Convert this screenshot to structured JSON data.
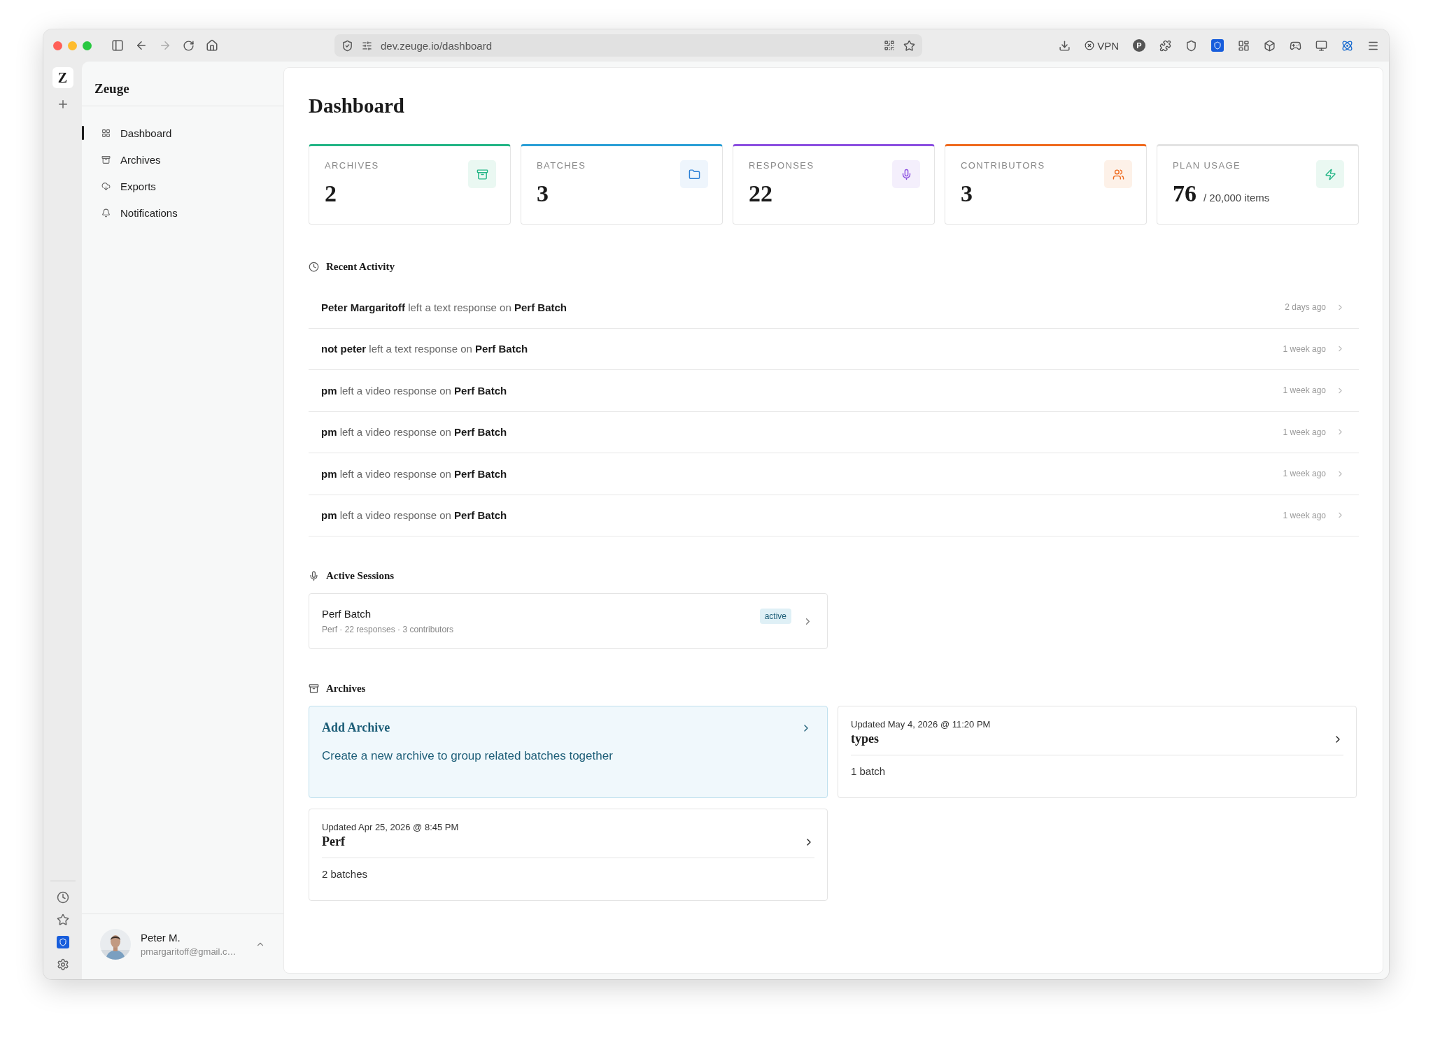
{
  "browser": {
    "url": "dev.zeuge.io/dashboard",
    "vpn_label": "VPN",
    "extension_letter": "P"
  },
  "app": {
    "logo_letter": "Z",
    "name": "Zeuge"
  },
  "nav": [
    {
      "label": "Dashboard",
      "selected": true
    },
    {
      "label": "Archives",
      "selected": false
    },
    {
      "label": "Exports",
      "selected": false
    },
    {
      "label": "Notifications",
      "selected": false
    }
  ],
  "user": {
    "name": "Peter M.",
    "email": "pmargaritoff@gmail.c…"
  },
  "page_title": "Dashboard",
  "stats": [
    {
      "label": "ARCHIVES",
      "value": "2",
      "color": "#22b585"
    },
    {
      "label": "BATCHES",
      "value": "3",
      "color": "#2a9fd6"
    },
    {
      "label": "RESPONSES",
      "value": "22",
      "color": "#8b4ee0"
    },
    {
      "label": "CONTRIBUTORS",
      "value": "3",
      "color": "#ef6a1e"
    },
    {
      "label": "PLAN USAGE",
      "value": "76",
      "suffix": "/ 20,000 items",
      "color": "#e3e3e3"
    }
  ],
  "recent_activity": {
    "title": "Recent Activity",
    "items": [
      {
        "text": "**Peter Margaritoff** left a text response on **Perf Batch**",
        "time": "2 days ago"
      },
      {
        "text": "**not peter** left a text response on **Perf Batch**",
        "time": "1 week ago"
      },
      {
        "text": "**pm** left a video response on **Perf Batch**",
        "time": "1 week ago"
      },
      {
        "text": "**pm** left a video response on **Perf Batch**",
        "time": "1 week ago"
      },
      {
        "text": "**pm** left a video response on **Perf Batch**",
        "time": "1 week ago"
      },
      {
        "text": "**pm** left a video response on **Perf Batch**",
        "time": "1 week ago"
      }
    ]
  },
  "active_sessions": {
    "title": "Active Sessions",
    "items": [
      {
        "name": "Perf Batch",
        "meta": "Perf · 22 responses · 3 contributors",
        "status": "active"
      }
    ]
  },
  "archives": {
    "title": "Archives",
    "add_card": {
      "title": "Add Archive",
      "description": "Create a new archive to group related batches together"
    },
    "items": [
      {
        "updated": "Updated May 4, 2026 @ 11:20 PM",
        "name": "types",
        "count": "1 batch"
      },
      {
        "updated": "Updated Apr 25, 2026 @ 8:45 PM",
        "name": "Perf",
        "count": "2 batches"
      }
    ]
  }
}
